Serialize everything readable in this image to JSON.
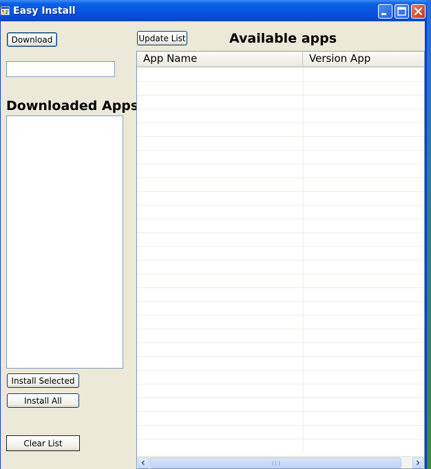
{
  "window": {
    "title": "Easy Install",
    "icon": "app-window-icon"
  },
  "titlebar_buttons": {
    "minimize_icon": "minimize-icon",
    "maximize_icon": "maximize-icon",
    "close_icon": "close-icon"
  },
  "left_panel": {
    "download_label": "Download",
    "url_input_value": "",
    "downloaded_heading": "Downloaded Apps",
    "downloaded_items": [],
    "install_selected_label": "Install Selected",
    "install_all_label": "Install All",
    "clear_list_label": "Clear List"
  },
  "right_panel": {
    "update_list_label": "Update List",
    "available_heading": "Available apps",
    "columns": [
      "App Name",
      "Version App"
    ],
    "rows": []
  },
  "colors": {
    "titlebar": "#0653dc",
    "client_background": "#ece9d8",
    "button_border": "#003c74",
    "field_border": "#7f9db9"
  }
}
